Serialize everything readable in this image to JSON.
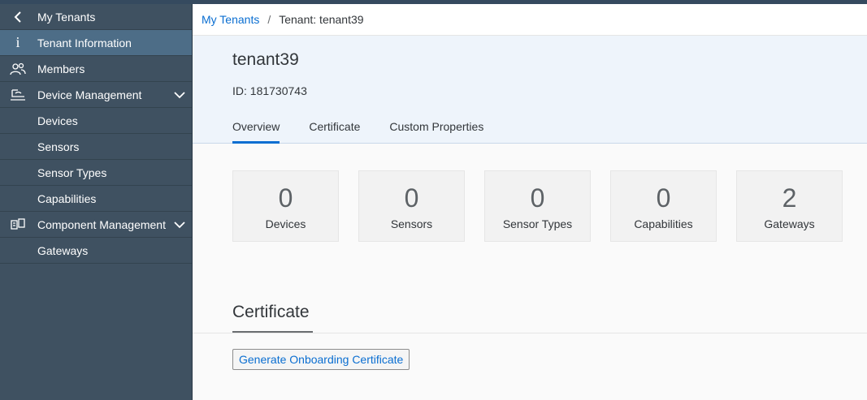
{
  "sidebar": {
    "items": [
      {
        "label": "My Tenants",
        "icon": "chevron-left-icon"
      },
      {
        "label": "Tenant Information",
        "icon": "info-icon"
      },
      {
        "label": "Members",
        "icon": "people-icon"
      },
      {
        "label": "Device Management",
        "icon": "device-management-icon"
      },
      {
        "label": "Devices"
      },
      {
        "label": "Sensors"
      },
      {
        "label": "Sensor Types"
      },
      {
        "label": "Capabilities"
      },
      {
        "label": "Component Management",
        "icon": "component-management-icon"
      },
      {
        "label": "Gateways"
      }
    ]
  },
  "breadcrumb": {
    "link": "My Tenants",
    "separator": "/",
    "current": "Tenant: tenant39"
  },
  "header": {
    "title": "tenant39",
    "id_line": "ID: 181730743"
  },
  "tabs": [
    {
      "label": "Overview",
      "active": true
    },
    {
      "label": "Certificate"
    },
    {
      "label": "Custom Properties"
    }
  ],
  "tiles": [
    {
      "value": "0",
      "label": "Devices"
    },
    {
      "value": "0",
      "label": "Sensors"
    },
    {
      "value": "0",
      "label": "Sensor Types"
    },
    {
      "value": "0",
      "label": "Capabilities"
    },
    {
      "value": "2",
      "label": "Gateways"
    }
  ],
  "certificate": {
    "title": "Certificate",
    "button": "Generate Onboarding Certificate"
  },
  "colors": {
    "sidebar": "#3f5161",
    "selected": "#4d6d87",
    "accent": "#0a6ed1",
    "header_bg": "#eef4fb"
  }
}
